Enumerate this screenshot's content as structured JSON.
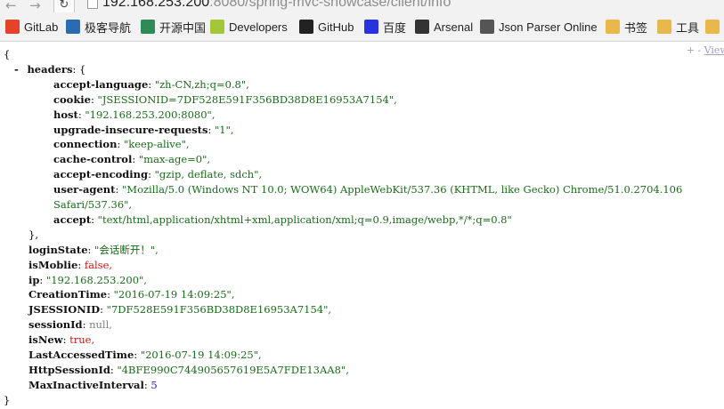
{
  "browser": {
    "back_glyph": "←",
    "forward_glyph": "→",
    "reload_glyph": "↻",
    "url_host": "192.168.253.200",
    "url_rest": ":8080/spring-mvc-showcase/client/info"
  },
  "bookmarks": [
    {
      "label": "GitLab",
      "icon": "gitlab-icon",
      "color": "#e24329"
    },
    {
      "label": "极客导航",
      "icon": "doc-icon",
      "color": "#2b6cb0"
    },
    {
      "label": "开源中国",
      "icon": "oschina-icon",
      "color": "#2e8b57"
    },
    {
      "label": "Developers",
      "icon": "android-icon",
      "color": "#a4c639"
    },
    {
      "label": "GitHub",
      "icon": "github-icon",
      "color": "#222222"
    },
    {
      "label": "百度",
      "icon": "baidu-icon",
      "color": "#2932e1"
    },
    {
      "label": "Arsenal",
      "icon": "arsenal-icon",
      "color": "#333333"
    },
    {
      "label": "Json Parser Online",
      "icon": "json-icon",
      "color": "#555555"
    },
    {
      "label": "书签",
      "icon": "folder-icon",
      "color": "#e8b84a"
    },
    {
      "label": "工具",
      "icon": "folder-icon",
      "color": "#e8b84a"
    },
    {
      "label": "",
      "icon": "folder-icon",
      "color": "#e8b84a"
    }
  ],
  "viewer": {
    "view_source_prefix": "+ -",
    "view_source_label": "View s",
    "open_brace": "{",
    "close_brace": "}",
    "collapse_toggle": "-",
    "headers_key": "headers",
    "headers_open": ": {",
    "headers_close": "},",
    "headers": [
      {
        "key": "accept-language",
        "value": "\"zh-CN,zh;q=0.8\"",
        "type": "string"
      },
      {
        "key": "cookie",
        "value": "\"JSESSIONID=7DF528E591F356BD38D8E16953A7154\"",
        "type": "string"
      },
      {
        "key": "host",
        "value": "\"192.168.253.200:8080\"",
        "type": "string"
      },
      {
        "key": "upgrade-insecure-requests",
        "value": "\"1\"",
        "type": "string"
      },
      {
        "key": "connection",
        "value": "\"keep-alive\"",
        "type": "string"
      },
      {
        "key": "cache-control",
        "value": "\"max-age=0\"",
        "type": "string"
      },
      {
        "key": "accept-encoding",
        "value": "\"gzip, deflate, sdch\"",
        "type": "string"
      },
      {
        "key": "user-agent",
        "value": "\"Mozilla/5.0 (Windows NT 10.0; WOW64) AppleWebKit/537.36 (KHTML, like Gecko) Chrome/51.0.2704.106",
        "value_cont": "Safari/537.36\"",
        "type": "string"
      },
      {
        "key": "accept",
        "value": "\"text/html,application/xhtml+xml,application/xml;q=0.9,image/webp,*/*;q=0.8\"",
        "type": "string"
      }
    ],
    "fields": [
      {
        "key": "loginState",
        "value": "\"会话断开！\"",
        "type": "string"
      },
      {
        "key": "isMoblie",
        "value": "false",
        "type": "bool"
      },
      {
        "key": "ip",
        "value": "\"192.168.253.200\"",
        "type": "string"
      },
      {
        "key": "CreationTime",
        "value": "\"2016-07-19 14:09:25\"",
        "type": "string"
      },
      {
        "key": "JSESSIONID",
        "value": "\"7DF528E591F356BD38D8E16953A7154\"",
        "type": "string"
      },
      {
        "key": "sessionId",
        "value": "null",
        "type": "null"
      },
      {
        "key": "isNew",
        "value": "true",
        "type": "bool"
      },
      {
        "key": "LastAccessedTime",
        "value": "\"2016-07-19 14:09:25\"",
        "type": "string"
      },
      {
        "key": "HttpSessionId",
        "value": "\"4BFE990C744905657619E5A7FDE13AA8\"",
        "type": "string"
      },
      {
        "key": "MaxInactiveInterval",
        "value": "5",
        "type": "number"
      }
    ]
  }
}
